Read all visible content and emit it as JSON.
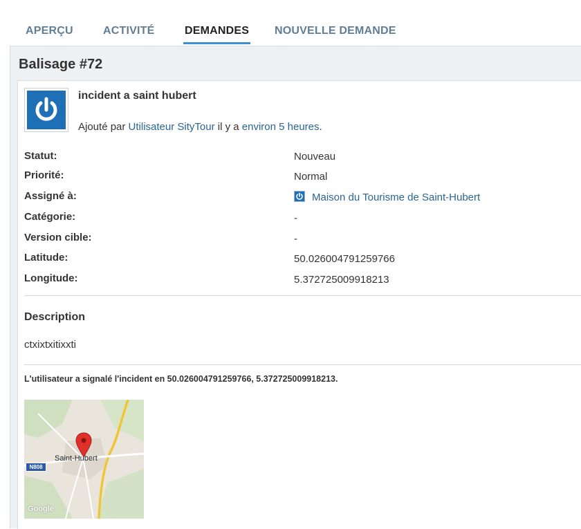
{
  "tabs": [
    {
      "label": "APERÇU",
      "active": false
    },
    {
      "label": "ACTIVITÉ",
      "active": false
    },
    {
      "label": "DEMANDES",
      "active": true
    },
    {
      "label": "NOUVELLE DEMANDE",
      "active": false
    }
  ],
  "issue": {
    "title": "Balisage #72",
    "subject": "incident a saint hubert",
    "added_prefix": "Ajouté par ",
    "author": "Utilisateur SityTour",
    "added_middle": " il y a ",
    "age": "environ 5 heures",
    "added_suffix": ".",
    "attributes": [
      {
        "label": "Statut:",
        "value": "Nouveau"
      },
      {
        "label": "Priorité:",
        "value": "Normal"
      },
      {
        "label": "Assigné à:",
        "value": "Maison du Tourisme de Saint-Hubert"
      },
      {
        "label": "Catégorie:",
        "value": "-"
      },
      {
        "label": "Version cible:",
        "value": "-"
      },
      {
        "label": "Latitude:",
        "value": "50.026004791259766"
      },
      {
        "label": "Longitude:",
        "value": "5.372725009918213"
      }
    ],
    "description_title": "Description",
    "description": "ctxixtxitixxti",
    "reported": "L'utilisateur a signalé l'incident en 50.026004791259766, 5.372725009918213."
  },
  "map": {
    "town_label": "Saint-Hubert",
    "road_label": "N808",
    "attribution": "Google",
    "marker_color": "#e0302b"
  },
  "colors": {
    "tab_text": "#5f7d95",
    "tab_active_underline": "#3e8fd0",
    "link": "#2a6496",
    "panel_bg": "#eef1f4",
    "avatar_blue": "#1f6fb7"
  }
}
